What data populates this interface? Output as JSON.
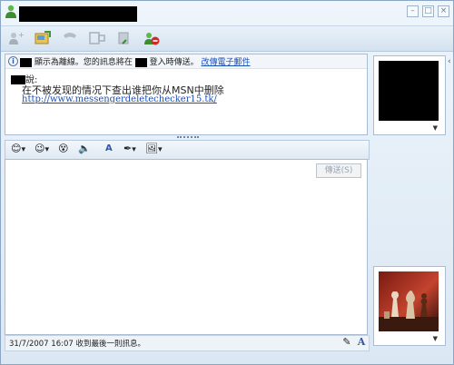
{
  "window": {
    "controls": {
      "minimize": "–",
      "maximize": "□",
      "close": "×"
    }
  },
  "toolbar": {
    "icons": [
      "invite-contact-icon",
      "send-file-icon",
      "voice-call-icon",
      "video-icon",
      "block-icon",
      "remove-contact-icon"
    ]
  },
  "infobar": {
    "text1": "顯示為離線。您的訊息將在",
    "text2": "登入時傳送。",
    "link": "改傳電子郵件"
  },
  "conversation": {
    "said_suffix": "說:",
    "message": "在不被发现的情况下查出谁把你从MSN中删除",
    "link": "http://www.messengerdeletechecker15.tk/"
  },
  "compose": {
    "send_button": "傳送(S)",
    "tools": [
      "emoticon-icon",
      "wink-icon",
      "nudge-icon",
      "voice-clip-icon",
      "font-icon",
      "pen-icon",
      "background-icon"
    ]
  },
  "status": {
    "text": "31/7/2007 16:07 收到最後一則訊息。"
  },
  "colors": {
    "link": "#1a4fb4",
    "frame": "#a9bdd2",
    "background": "#dbe7f3"
  }
}
